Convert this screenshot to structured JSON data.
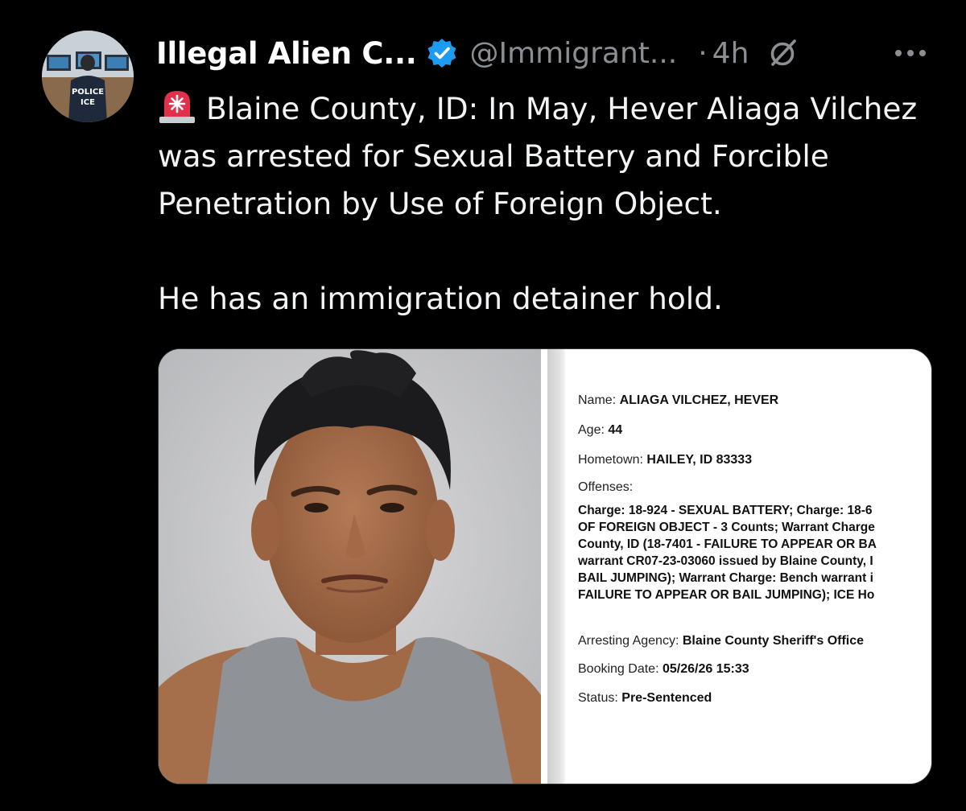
{
  "author": {
    "display_name": "Illegal Alien C...",
    "handle": "@Immigrant...",
    "separator": "·",
    "time": "4h",
    "avatar_text_line1": "POLICE",
    "avatar_text_line2": "ICE",
    "verified": true
  },
  "tweet": {
    "paragraph1": "Blaine County, ID: In May, Hever Aliaga Vilchez was arrested for Sexual Battery and Forcible Penetration by Use of Foreign Object.",
    "paragraph2": "He has an immigration detainer hold.",
    "emoji_icon": "police-siren-icon"
  },
  "record": {
    "name_label": "Name:",
    "name_value": "ALIAGA VILCHEZ, HEVER",
    "age_label": "Age:",
    "age_value": "44",
    "hometown_label": "Hometown:",
    "hometown_value": "HAILEY, ID 83333",
    "offenses_label": "Offenses:",
    "offense_lines": [
      "Charge: 18-924 - SEXUAL BATTERY; Charge: 18-6",
      "OF FOREIGN OBJECT - 3 Counts; Warrant Charge",
      "County, ID (18-7401 - FAILURE TO APPEAR OR BA",
      "warrant CR07-23-03060 issued by Blaine County, I",
      "BAIL JUMPING); Warrant Charge: Bench warrant i",
      "FAILURE TO APPEAR OR BAIL JUMPING); ICE Ho"
    ],
    "agency_label": "Arresting Agency:",
    "agency_value": "Blaine County Sheriff's Office",
    "booking_label": "Booking Date:",
    "booking_value": "05/26/26 15:33",
    "status_label": "Status:",
    "status_value": "Pre-Sentenced"
  },
  "colors": {
    "background": "#000000",
    "text_primary": "#e7e9ea",
    "text_secondary": "#8b8f94",
    "verified_blue": "#1d9bf0",
    "siren_red": "#e0304a"
  },
  "icons": {
    "verified": "verified-badge-icon",
    "grok": "grok-icon",
    "more": "more-options-icon"
  }
}
